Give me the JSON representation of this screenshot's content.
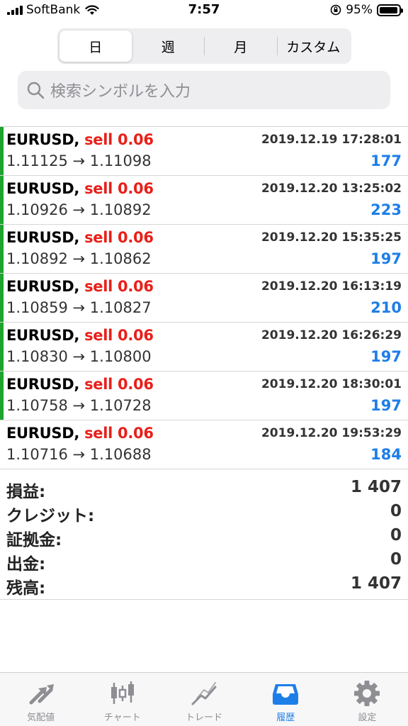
{
  "status_bar": {
    "carrier": "SoftBank",
    "time": "7:57",
    "battery": "95%",
    "battery_level": 0.95
  },
  "period_tabs": [
    {
      "label": "日",
      "active": true
    },
    {
      "label": "週",
      "active": false
    },
    {
      "label": "月",
      "active": false
    },
    {
      "label": "カスタム",
      "active": false
    }
  ],
  "search": {
    "placeholder": "検索シンボルを入力"
  },
  "deals": [
    {
      "symbol": "EURUSD",
      "side": "sell 0.06",
      "time": "2019.12.19 17:28:01",
      "prices": "1.11125 → 1.11098",
      "profit": "177"
    },
    {
      "symbol": "EURUSD",
      "side": "sell 0.06",
      "time": "2019.12.20 13:25:02",
      "prices": "1.10926 → 1.10892",
      "profit": "223"
    },
    {
      "symbol": "EURUSD",
      "side": "sell 0.06",
      "time": "2019.12.20 15:35:25",
      "prices": "1.10892 → 1.10862",
      "profit": "197"
    },
    {
      "symbol": "EURUSD",
      "side": "sell 0.06",
      "time": "2019.12.20 16:13:19",
      "prices": "1.10859 → 1.10827",
      "profit": "210"
    },
    {
      "symbol": "EURUSD",
      "side": "sell 0.06",
      "time": "2019.12.20 16:26:29",
      "prices": "1.10830 → 1.10800",
      "profit": "197"
    },
    {
      "symbol": "EURUSD",
      "side": "sell 0.06",
      "time": "2019.12.20 18:30:01",
      "prices": "1.10758 → 1.10728",
      "profit": "197"
    },
    {
      "symbol": "EURUSD",
      "side": "sell 0.06",
      "time": "2019.12.20 19:53:29",
      "prices": "1.10716 → 1.10688",
      "profit": "184"
    }
  ],
  "summary": [
    {
      "label": "損益:",
      "value": "1 407"
    },
    {
      "label": "クレジット:",
      "value": "0"
    },
    {
      "label": "証拠金:",
      "value": "0"
    },
    {
      "label": "出金:",
      "value": "0"
    },
    {
      "label": "残高:",
      "value": "1 407"
    }
  ],
  "tabbar": [
    {
      "label": "気配値",
      "icon": "quotes-arrows-icon",
      "active": false
    },
    {
      "label": "チャート",
      "icon": "candlestick-chart-icon",
      "active": false
    },
    {
      "label": "トレード",
      "icon": "trade-trend-icon",
      "active": false
    },
    {
      "label": "履歴",
      "icon": "history-tray-icon",
      "active": true
    },
    {
      "label": "設定",
      "icon": "settings-gear-icon",
      "active": false
    }
  ],
  "colors": {
    "accent": "#1e7ee8",
    "sell": "#e8201a",
    "deal_bar": "#1ea32f",
    "inactive": "#8e8e93"
  }
}
